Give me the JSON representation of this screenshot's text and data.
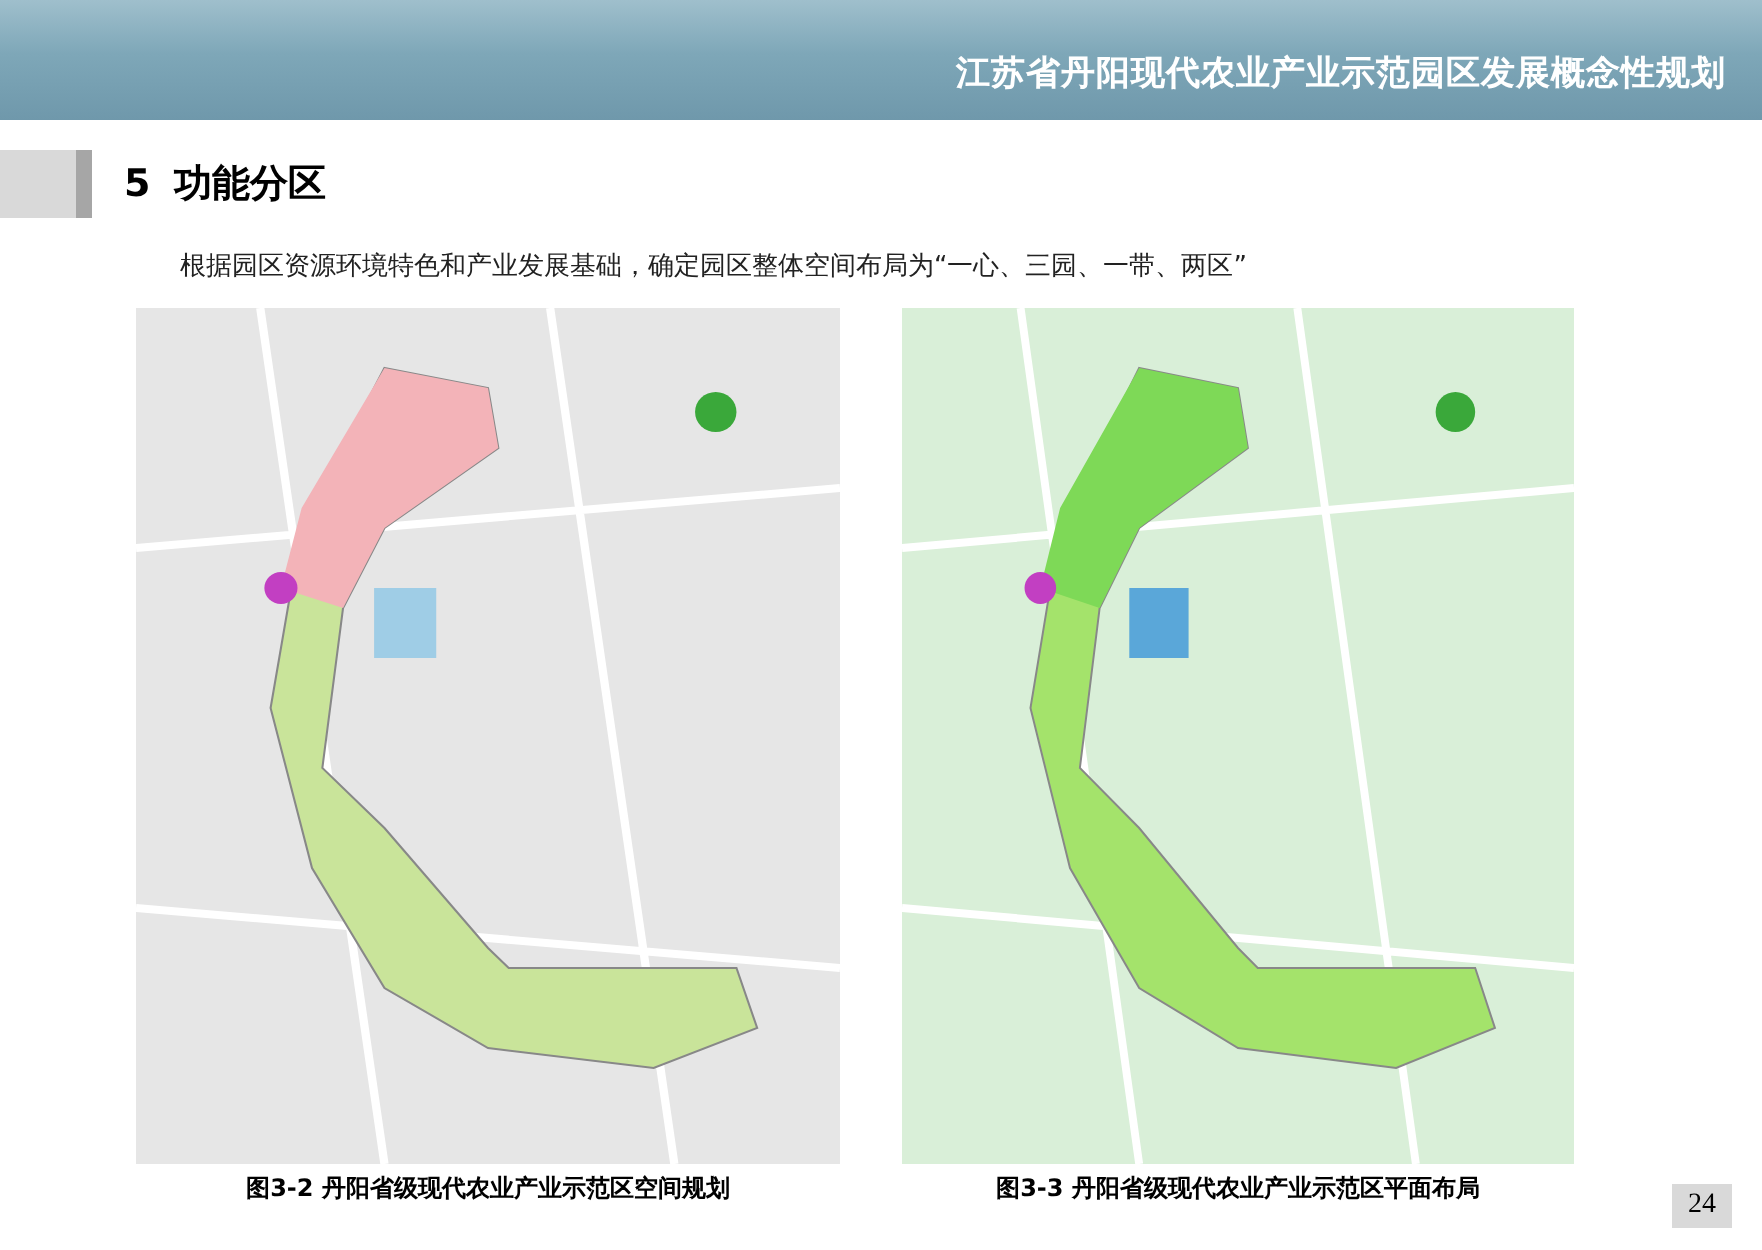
{
  "header": {
    "title": "江苏省丹阳现代农业产业示范园区发展概念性规划"
  },
  "section": {
    "number": "5",
    "title": "功能分区"
  },
  "intro": "根据园区资源环境特色和产业发展基础，确定园区整体空间布局为“一心、三园、一带、两区”",
  "figures": [
    {
      "kind": "zoning",
      "caption": "图3-2  丹阳省级现代农业产业示范区空间规划"
    },
    {
      "kind": "plan",
      "caption": "图3-3  丹阳省级现代农业产业示范区平面布局"
    }
  ],
  "page_number": "24"
}
